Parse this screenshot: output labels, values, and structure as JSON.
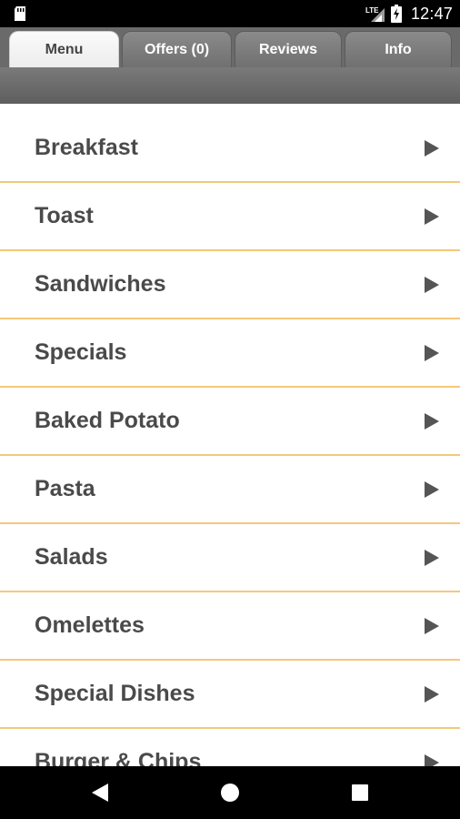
{
  "status_bar": {
    "network_label": "LTE",
    "time": "12:47"
  },
  "tabs": [
    {
      "label": "Menu",
      "active": true
    },
    {
      "label": "Offers (0)",
      "active": false
    },
    {
      "label": "Reviews",
      "active": false
    },
    {
      "label": "Info",
      "active": false
    }
  ],
  "menu": {
    "items": [
      {
        "label": "Breakfast"
      },
      {
        "label": "Toast"
      },
      {
        "label": "Sandwiches"
      },
      {
        "label": "Specials"
      },
      {
        "label": "Baked Potato"
      },
      {
        "label": "Pasta"
      },
      {
        "label": "Salads"
      },
      {
        "label": "Omelettes"
      },
      {
        "label": "Special Dishes"
      },
      {
        "label": "Burger & Chips"
      }
    ],
    "arrow_icon": "chevron-right-icon"
  },
  "colors": {
    "divider": "#f5c87a",
    "text": "#4a4a4a",
    "tab_bar": "#6a6a6a"
  },
  "nav_bar": {
    "icons": [
      "back-icon",
      "home-icon",
      "recents-icon"
    ]
  }
}
